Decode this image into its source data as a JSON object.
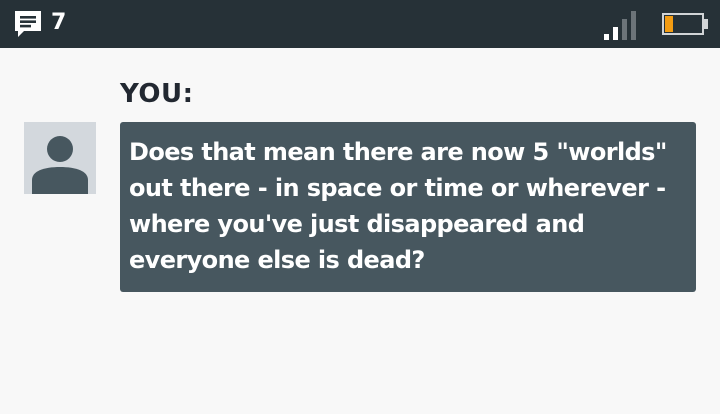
{
  "status_bar": {
    "message_icon": "chat-bubble-icon",
    "message_count": "7",
    "signal_icon": "signal-bars-icon",
    "battery_icon": "battery-low-icon",
    "battery_color": "#f39c12",
    "background": "#263137"
  },
  "conversation": {
    "speaker_label": "YOU:",
    "avatar_icon": "user-avatar-icon",
    "message_text": "Does that mean there are now 5 \"worlds\" out there - in space or time or wherever - where you've just disappeared and everyone else is dead?",
    "bubble_color": "#47575f"
  }
}
